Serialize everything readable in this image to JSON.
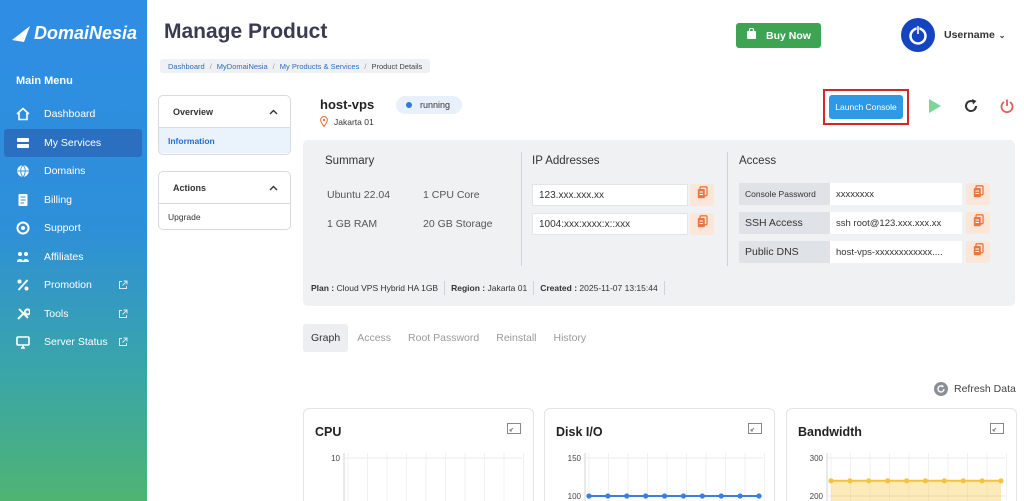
{
  "sidebar": {
    "logo_text": "DomaiNesia",
    "menu_title": "Main Menu",
    "items": [
      {
        "label": "Dashboard",
        "icon": "home-icon"
      },
      {
        "label": "My Services",
        "icon": "server-icon",
        "active": true
      },
      {
        "label": "Domains",
        "icon": "globe-icon"
      },
      {
        "label": "Billing",
        "icon": "billing-icon"
      },
      {
        "label": "Support",
        "icon": "support-icon"
      },
      {
        "label": "Affiliates",
        "icon": "affiliates-icon"
      },
      {
        "label": "Promotion",
        "icon": "percent-icon",
        "external": true
      },
      {
        "label": "Tools",
        "icon": "tools-icon",
        "external": true
      },
      {
        "label": "Server Status",
        "icon": "monitor-icon",
        "external": true
      }
    ]
  },
  "header": {
    "title": "Manage Product",
    "breadcrumb": [
      "Dashboard",
      "MyDomaiNesia",
      "My Products & Services",
      "Product Details"
    ],
    "buy_now": "Buy Now",
    "username": "Username"
  },
  "panels": {
    "overview": {
      "title": "Overview",
      "items": [
        "Information"
      ]
    },
    "actions": {
      "title": "Actions",
      "items": [
        "Upgrade"
      ]
    }
  },
  "host": {
    "name": "host-vps",
    "status": "running",
    "location": "Jakarta 01",
    "launch_console": "Launch Console"
  },
  "summary": {
    "title": "Summary",
    "os": "Ubuntu 22.04",
    "cpu": "1 CPU Core",
    "ram": "1 GB RAM",
    "storage": "20 GB Storage"
  },
  "ip": {
    "title": "IP Addresses",
    "ipv4": "123.xxx.xxx.xx",
    "ipv6": "1004:xxx:xxxx:x::xxx"
  },
  "access": {
    "title": "Access",
    "rows": [
      {
        "label": "Console Password",
        "value": "xxxxxxxx"
      },
      {
        "label": "SSH Access",
        "value": "ssh root@123.xxx.xxx.xx"
      },
      {
        "label": "Public DNS",
        "value": "host-vps-xxxxxxxxxxxx...."
      }
    ]
  },
  "plan": {
    "plan_label": "Plan :",
    "plan_value": "Cloud VPS Hybrid HA 1GB",
    "region_label": "Region :",
    "region_value": "Jakarta 01",
    "created_label": "Created :",
    "created_value": "2025-11-07 13:15:44"
  },
  "tabs": [
    "Graph",
    "Access",
    "Root Password",
    "Reinstall",
    "History"
  ],
  "refresh_label": "Refresh Data",
  "colors": {
    "accent": "#2c9ae6",
    "buy": "#3ea453",
    "highlight": "#d6262a",
    "copy_bg": "#fbe6da",
    "copy_icon": "#e8773f"
  },
  "chart_data": [
    {
      "type": "line",
      "title": "CPU",
      "yticks": [
        10
      ],
      "series_color": "#3a7fe0"
    },
    {
      "type": "line",
      "title": "Disk I/O",
      "yticks": [
        150,
        100
      ],
      "series": [
        {
          "values": [
            100,
            100,
            100,
            100,
            100,
            100,
            100,
            100,
            100,
            100
          ]
        }
      ],
      "series_color": "#3a7fe0"
    },
    {
      "type": "area",
      "title": "Bandwidth",
      "yticks": [
        300,
        200
      ],
      "series": [
        {
          "values": [
            240,
            240,
            240,
            240,
            240,
            240,
            240,
            240,
            240,
            240
          ]
        }
      ],
      "series_color": "#f5c33b"
    }
  ]
}
